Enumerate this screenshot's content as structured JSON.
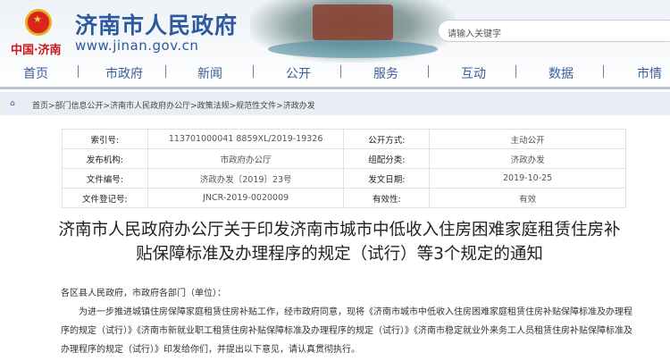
{
  "header": {
    "site_title": "济南市人民政府",
    "site_url": "www.jinan.gov.cn",
    "city_mark": "中国·济南",
    "search_placeholder": "请输入关键字"
  },
  "nav": [
    "首页",
    "市政府",
    "新闻",
    "公开",
    "服务",
    "互动",
    "数据",
    "市情"
  ],
  "breadcrumb": "首页>部门信息公开>济南市人民政府办公厅>政策法规>规范性文件>济政办发",
  "meta": [
    {
      "l1": "索引号:",
      "v1": "113701000041 8859XL/2019-19326",
      "l2": "公开方式:",
      "v2": "主动公开"
    },
    {
      "l1": "发布机构:",
      "v1": "市政府办公厅",
      "l2": "组配分类:",
      "v2": "济政办发"
    },
    {
      "l1": "文件编号:",
      "v1": "济政办发〔2019〕23号",
      "l2": "发文日期:",
      "v2": "2019-10-25"
    },
    {
      "l1": "文件登记号:",
      "v1": "JNCR-2019-0020009",
      "l2": "有效性:",
      "v2": "有效"
    }
  ],
  "doc_title": "济南市人民政府办公厅关于印发济南市城市中低收入住房困难家庭租赁住房补贴保障标准及办理程序的规定（试行）等3个规定的通知",
  "body": {
    "salutation": "各区县人民政府，市政府各部门（单位）：",
    "paragraph": "为进一步推进城镇住房保障家庭租赁住房补贴工作，经市政府同意，现将《济南市城市中低收入住房困难家庭租赁住房补贴保障标准及办理程序的规定（试行）》《济南市新就业职工租赁住房补贴保障标准及办理程序的规定（试行）》《济南市稳定就业外来务工人员租赁住房补贴保障标准及办理程序的规定（试行）》印发给你们，并提出以下意见，请认真贯彻执行。"
  }
}
